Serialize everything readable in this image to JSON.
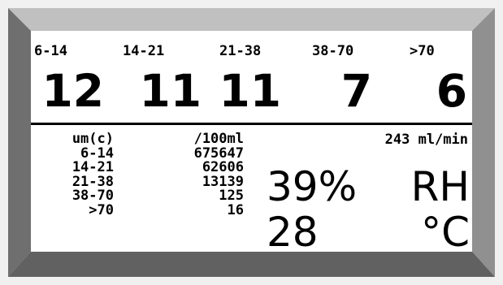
{
  "header": {
    "bins": [
      "6-14",
      "14-21",
      "21-38",
      "38-70",
      ">70"
    ],
    "counts": [
      "12",
      "11",
      "11",
      "7",
      "6"
    ]
  },
  "table": {
    "col1_header": "um(c)",
    "col2_header": "/100ml",
    "rows": [
      {
        "size": "6-14",
        "count": "675647"
      },
      {
        "size": "14-21",
        "count": "62606"
      },
      {
        "size": "21-38",
        "count": "13139"
      },
      {
        "size": "38-70",
        "count": "125"
      },
      {
        "size": ">70",
        "count": "16"
      }
    ]
  },
  "flow_rate": "243 ml/min",
  "humidity": {
    "value": "39%",
    "unit": "RH"
  },
  "temperature": {
    "value": "28",
    "unit": "°C"
  },
  "colors": {
    "bezel_light": "#d2d2d2",
    "bezel_top": "#bdbdbd",
    "bezel_side": "#8f8f8f",
    "bezel_dark": "#6e6e6e",
    "screen": "#ffffff",
    "text": "#000000"
  }
}
